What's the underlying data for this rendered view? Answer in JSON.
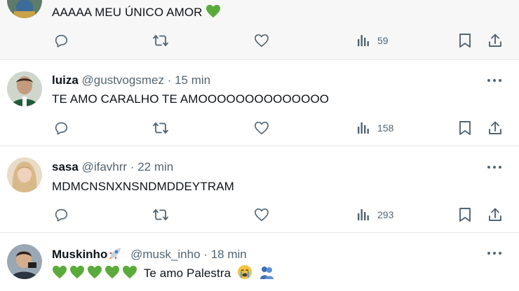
{
  "posts": [
    {
      "name": "",
      "handle": "",
      "time": "",
      "text": "AAAAA MEU ÚNICO AMOR",
      "views": "59",
      "avatar": "avatar-icon"
    },
    {
      "name": "luiza",
      "handle": "@gustvogsmez",
      "sep": "·",
      "time": "15 min",
      "text": "TE AMO CARALHO TE AMOOOOOOOOOOOOOO",
      "views": "158",
      "avatar": "avatar-icon"
    },
    {
      "name": "sasa",
      "handle": "@ifavhrr",
      "sep": "·",
      "time": "22 min",
      "text": "MDMCNSNXNSNDMDDEYTRAM",
      "views": "293",
      "avatar": "avatar-icon"
    },
    {
      "name": "Muskinho",
      "handle": "@musk_inho",
      "sep": "·",
      "time": "18 min",
      "text": "Te amo Palestra",
      "avatar": "avatar-icon"
    }
  ],
  "icons": {
    "reply": "reply-icon",
    "repost": "repost-icon",
    "like": "like-icon",
    "views": "views-icon",
    "bookmark": "bookmark-icon",
    "share": "share-icon",
    "more": "more-icon"
  },
  "colors": {
    "text": "#0f1419",
    "muted": "#536471",
    "green_heart": "#5bab3c",
    "divider": "#e6e8eb"
  }
}
